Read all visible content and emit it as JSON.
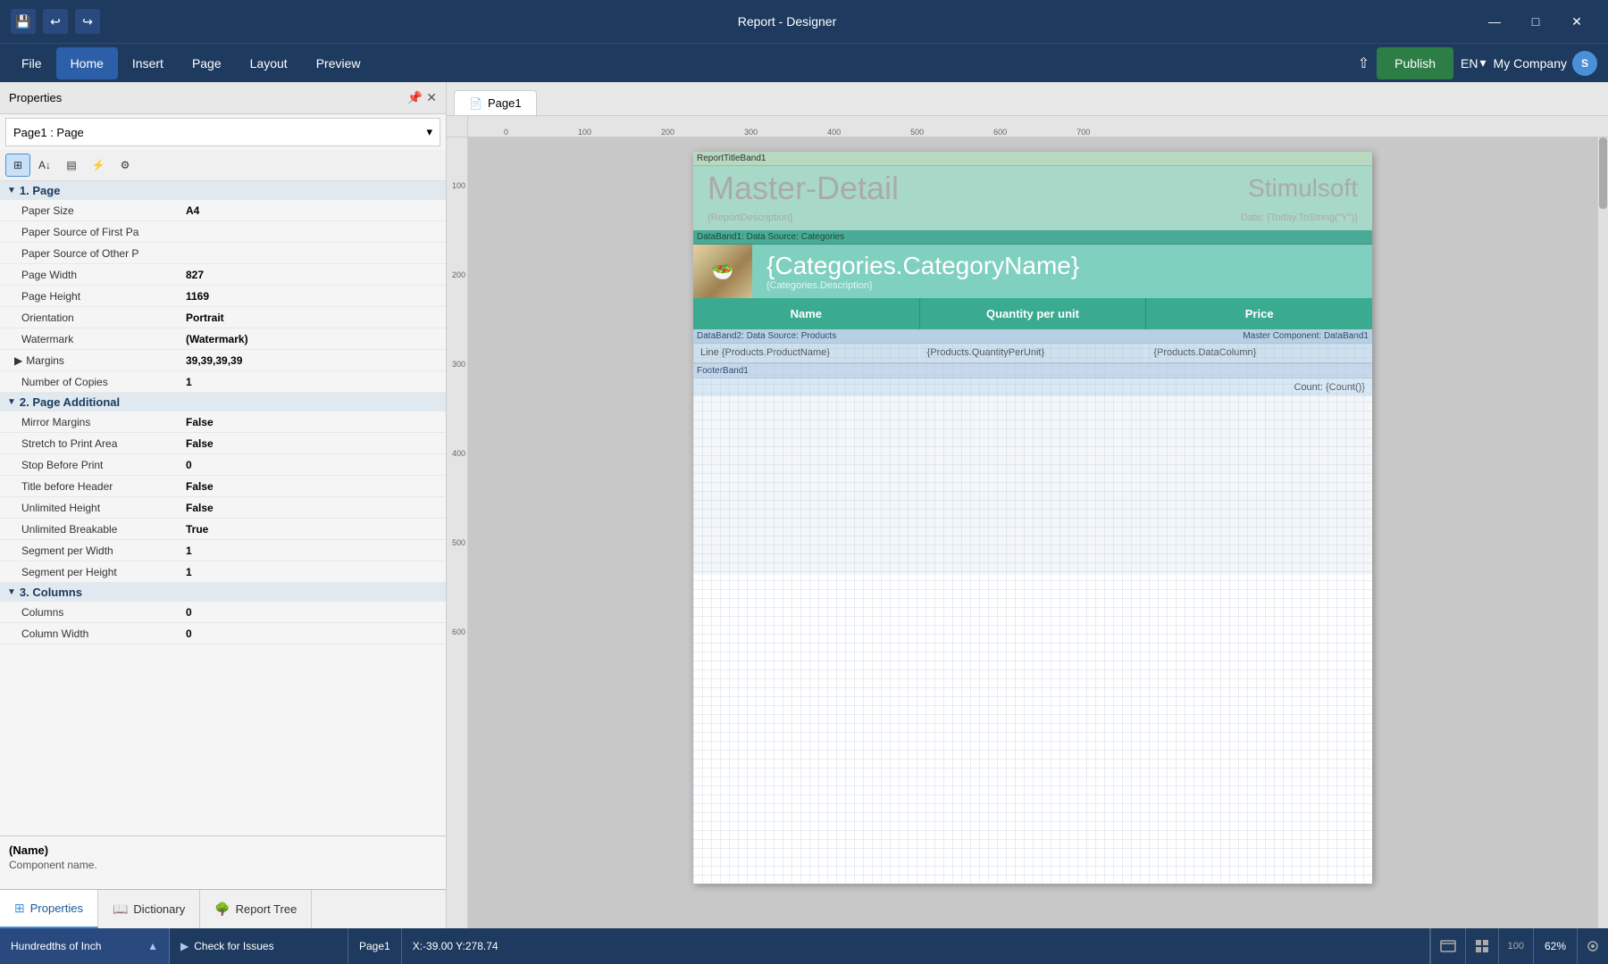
{
  "titleBar": {
    "title": "Report - Designer",
    "saveIcon": "💾",
    "undoIcon": "↩",
    "redoIcon": "↪",
    "minimizeIcon": "—",
    "maximizeIcon": "□",
    "closeIcon": "✕"
  },
  "menuBar": {
    "items": [
      "File",
      "Home",
      "Insert",
      "Page",
      "Layout",
      "Preview"
    ],
    "activeItem": "Home",
    "publishLabel": "Publish",
    "language": "EN",
    "company": "My Company"
  },
  "properties": {
    "title": "Properties",
    "selectedItem": "Page1 : Page",
    "sections": [
      {
        "id": "page",
        "label": "1. Page",
        "rows": [
          {
            "label": "Paper Size",
            "value": "A4",
            "bold": true
          },
          {
            "label": "Paper Source of First Pa",
            "value": ""
          },
          {
            "label": "Paper Source of Other P",
            "value": ""
          },
          {
            "label": "Page Width",
            "value": "827"
          },
          {
            "label": "Page Height",
            "value": "1169"
          },
          {
            "label": "Orientation",
            "value": "Portrait"
          },
          {
            "label": "Watermark",
            "value": "(Watermark)"
          },
          {
            "label": "Margins",
            "value": "39,39,39,39",
            "bold": true
          },
          {
            "label": "Number of Copies",
            "value": "1"
          }
        ]
      },
      {
        "id": "pageAdditional",
        "label": "2. Page  Additional",
        "rows": [
          {
            "label": "Mirror Margins",
            "value": "False"
          },
          {
            "label": "Stretch to Print Area",
            "value": "False"
          },
          {
            "label": "Stop Before Print",
            "value": "0"
          },
          {
            "label": "Title before Header",
            "value": "False"
          },
          {
            "label": "Unlimited Height",
            "value": "False"
          },
          {
            "label": "Unlimited Breakable",
            "value": "True"
          },
          {
            "label": "Segment per Width",
            "value": "1"
          },
          {
            "label": "Segment per Height",
            "value": "1"
          }
        ]
      },
      {
        "id": "columns",
        "label": "3. Columns",
        "rows": [
          {
            "label": "Columns",
            "value": "0"
          },
          {
            "label": "Column Width",
            "value": "0"
          }
        ]
      }
    ],
    "infoName": "(Name)",
    "infoDesc": "Component name."
  },
  "tabs": {
    "bottomTabs": [
      {
        "id": "properties",
        "label": "Properties",
        "icon": "⊞",
        "active": true
      },
      {
        "id": "dictionary",
        "label": "Dictionary",
        "icon": "📖"
      },
      {
        "id": "reportTree",
        "label": "Report Tree",
        "icon": "🌳"
      }
    ]
  },
  "canvas": {
    "pageTab": "Page1",
    "ruler": {
      "hMarks": [
        "0",
        "100",
        "200",
        "300",
        "400",
        "500",
        "600",
        "700"
      ],
      "vMarks": [
        "",
        "100",
        "200",
        "300",
        "400",
        "500",
        "600"
      ]
    },
    "report": {
      "titleBand": "ReportTitleBand1",
      "masterDetailText": "Master-Detail",
      "brandText": "Stimulsoft",
      "descriptionPlaceholder": "{ReportDescription}",
      "datePlaceholder": "Date: {Today.ToString(\"Y\")}",
      "dataBand1Label": "DataBand1: Data Source: Categories",
      "categoryNamePlaceholder": "{Categories.CategoryName}",
      "categoryDescPlaceholder": "{Categories.Description}",
      "tableHeaders": [
        "Name",
        "Quantity per unit",
        "Price"
      ],
      "dataBand2Label": "DataBand2: Data Source: Products",
      "dataBand2Master": "Master Component: DataBand1",
      "dataRow": {
        "col1": "Line  {Products.ProductName}",
        "col2": "{Products.QuantityPerUnit}",
        "col3": "{Products.DataColumn}"
      },
      "footerBand": "FooterBand1",
      "footerContent": "Count: {Count()}"
    }
  },
  "statusBar": {
    "units": "Hundredths of Inch",
    "checkIssues": "Check for Issues",
    "page": "Page1",
    "coords": "X:-39.00 Y:278.74",
    "zoom": "62%"
  }
}
